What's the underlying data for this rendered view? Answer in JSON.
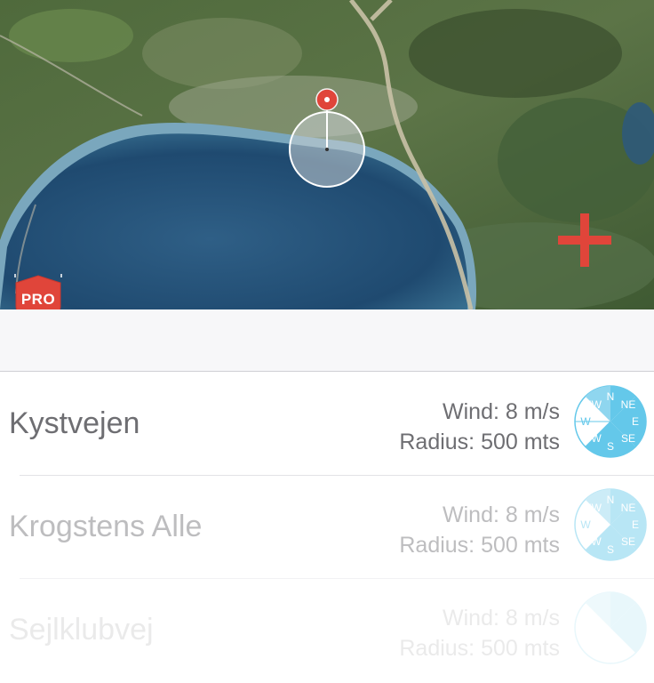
{
  "map": {
    "add_label": "add-location",
    "pro_badge": {
      "label": "PRO",
      "color": "#e0453a"
    }
  },
  "colors": {
    "accent_red": "#e0453a",
    "compass_fill": "#64c8ea",
    "text_gray": "#6e6e72"
  },
  "locations": [
    {
      "name": "Kystvejen",
      "wind": "Wind: 8 m/s",
      "radius": "Radius: 500 mts"
    },
    {
      "name": "Krogstens Alle",
      "wind": "Wind: 8 m/s",
      "radius": "Radius: 500 mts"
    },
    {
      "name": "Sejlklubvej",
      "wind": "Wind: 8 m/s",
      "radius": "Radius: 500 mts"
    }
  ],
  "compass": {
    "N": "N",
    "NE": "NE",
    "E": "E",
    "SE": "SE",
    "S": "S",
    "SW": "SW",
    "W": "W",
    "NW": "NW"
  }
}
